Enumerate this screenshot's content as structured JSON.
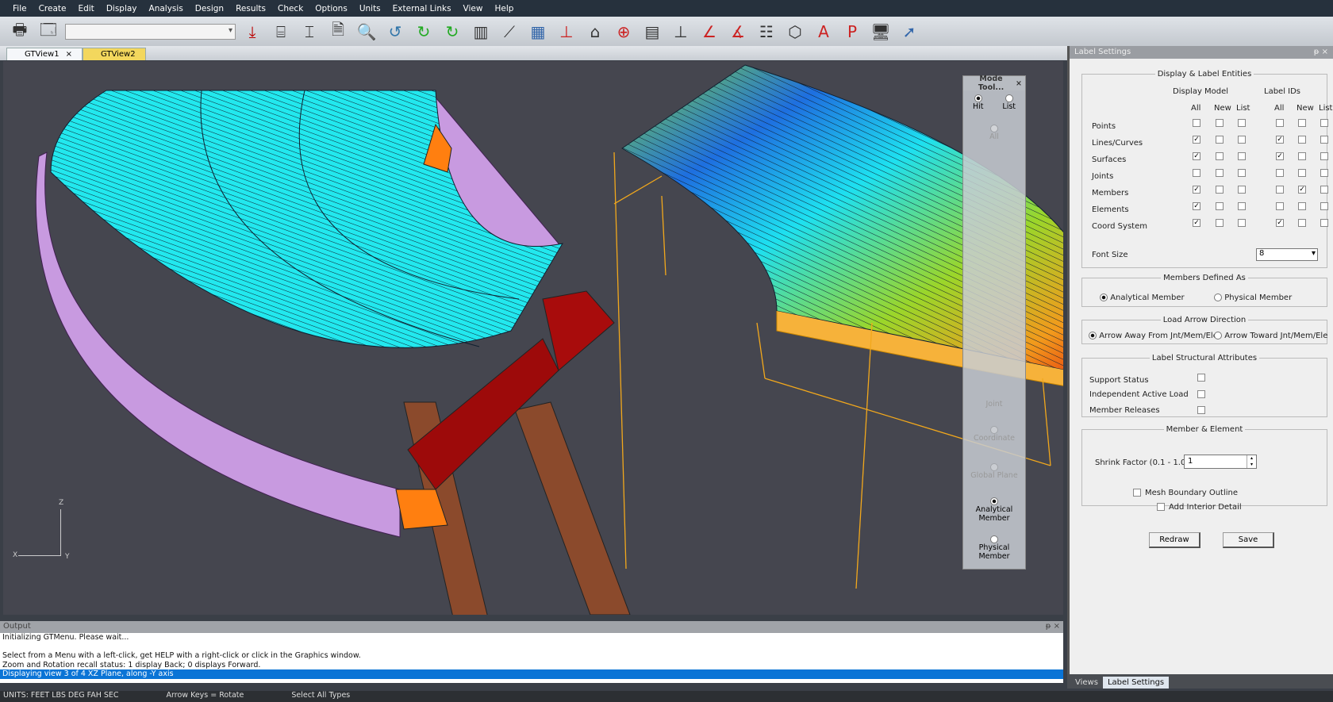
{
  "menu": [
    "File",
    "Create",
    "Edit",
    "Display",
    "Analysis",
    "Design",
    "Results",
    "Check",
    "Options",
    "Units",
    "External Links",
    "View",
    "Help"
  ],
  "toolbar": {
    "combo_value": "",
    "icons": [
      "print-icon",
      "info-window-icon",
      "download-icon",
      "frame-icon",
      "dimension-icon",
      "document-settings-icon",
      "zoom-icon",
      "undo-rotate-icon",
      "refresh-view-icon",
      "refresh-3d-icon",
      "chart-icon",
      "load-icon",
      "table-icon",
      "axis-icon",
      "house-icon",
      "globe-icon",
      "panel-icon",
      "support-icon",
      "angle-icon",
      "angle-play-icon",
      "checklist-icon",
      "mesh-icon",
      "text-a-icon",
      "text-p-icon",
      "monitor-icon",
      "select-cursor-icon"
    ]
  },
  "tabs": [
    {
      "label": "GTView1",
      "close": "×"
    },
    {
      "label": "GTView2"
    }
  ],
  "mode_tool": {
    "title": "Mode Tool...",
    "close": "×",
    "hit": "Hit",
    "list": "List",
    "all": "All",
    "joint": "Joint",
    "coordinate": "Coordinate",
    "global_plane": "Global Plane",
    "analytical": "Analytical Member",
    "physical": "Physical Member"
  },
  "axis": {
    "z": "Z",
    "x": "X",
    "y": "Y"
  },
  "label_settings": {
    "title": "Label Settings",
    "pin": "ᵽ",
    "close": "×",
    "display_group": "Display & Label Entities",
    "display_model": "Display Model",
    "label_ids": "Label IDs",
    "cols": [
      "All",
      "New",
      "List",
      "All",
      "New",
      "List"
    ],
    "rows": [
      {
        "label": "Points",
        "checks": [
          false,
          false,
          false,
          false,
          false,
          false
        ]
      },
      {
        "label": "Lines/Curves",
        "checks": [
          true,
          false,
          false,
          true,
          false,
          false
        ]
      },
      {
        "label": "Surfaces",
        "checks": [
          true,
          false,
          false,
          true,
          false,
          false
        ]
      },
      {
        "label": "Joints",
        "checks": [
          false,
          false,
          false,
          false,
          false,
          false
        ]
      },
      {
        "label": "Members",
        "checks": [
          true,
          false,
          false,
          false,
          true,
          false
        ]
      },
      {
        "label": "Elements",
        "checks": [
          true,
          false,
          false,
          false,
          false,
          false
        ]
      },
      {
        "label": "Coord System",
        "checks": [
          true,
          false,
          false,
          true,
          false,
          false
        ]
      }
    ],
    "font_size_label": "Font Size",
    "font_size": "8",
    "members_group": "Members Defined As",
    "analytical": "Analytical Member",
    "physical": "Physical Member",
    "arrow_group": "Load Arrow Direction",
    "arrow_away": "Arrow Away From Jnt/Mem/Ele",
    "arrow_toward": "Arrow Toward Jnt/Mem/Ele",
    "struct_group": "Label Structural Attributes",
    "support_status": "Support Status",
    "indep_load": "Independent Active Load",
    "member_releases": "Member Releases",
    "me_group": "Member & Element",
    "shrink_label": "Shrink Factor (0.1 - 1.0)",
    "shrink_value": "1",
    "mesh_boundary": "Mesh Boundary Outline",
    "interior_detail": "Add Interior Detail",
    "redraw": "Redraw",
    "save": "Save"
  },
  "panel_tabs": [
    "Views",
    "Label Settings"
  ],
  "output": {
    "title": "Output",
    "lines": [
      "Initializing GTMenu.  Please wait...",
      "",
      "Select from a Menu with a left-click, get HELP with a right-click or click in the Graphics window.",
      "Zoom and Rotation recall status:    1 display Back;     0 displays Forward.",
      "Displaying view 3 of 4   XZ Plane, along -Y axis"
    ]
  },
  "status": [
    "UNITS:  FEET  LBS  DEG  FAH  SEC",
    "Arrow Keys = Rotate",
    "Select All Types"
  ]
}
